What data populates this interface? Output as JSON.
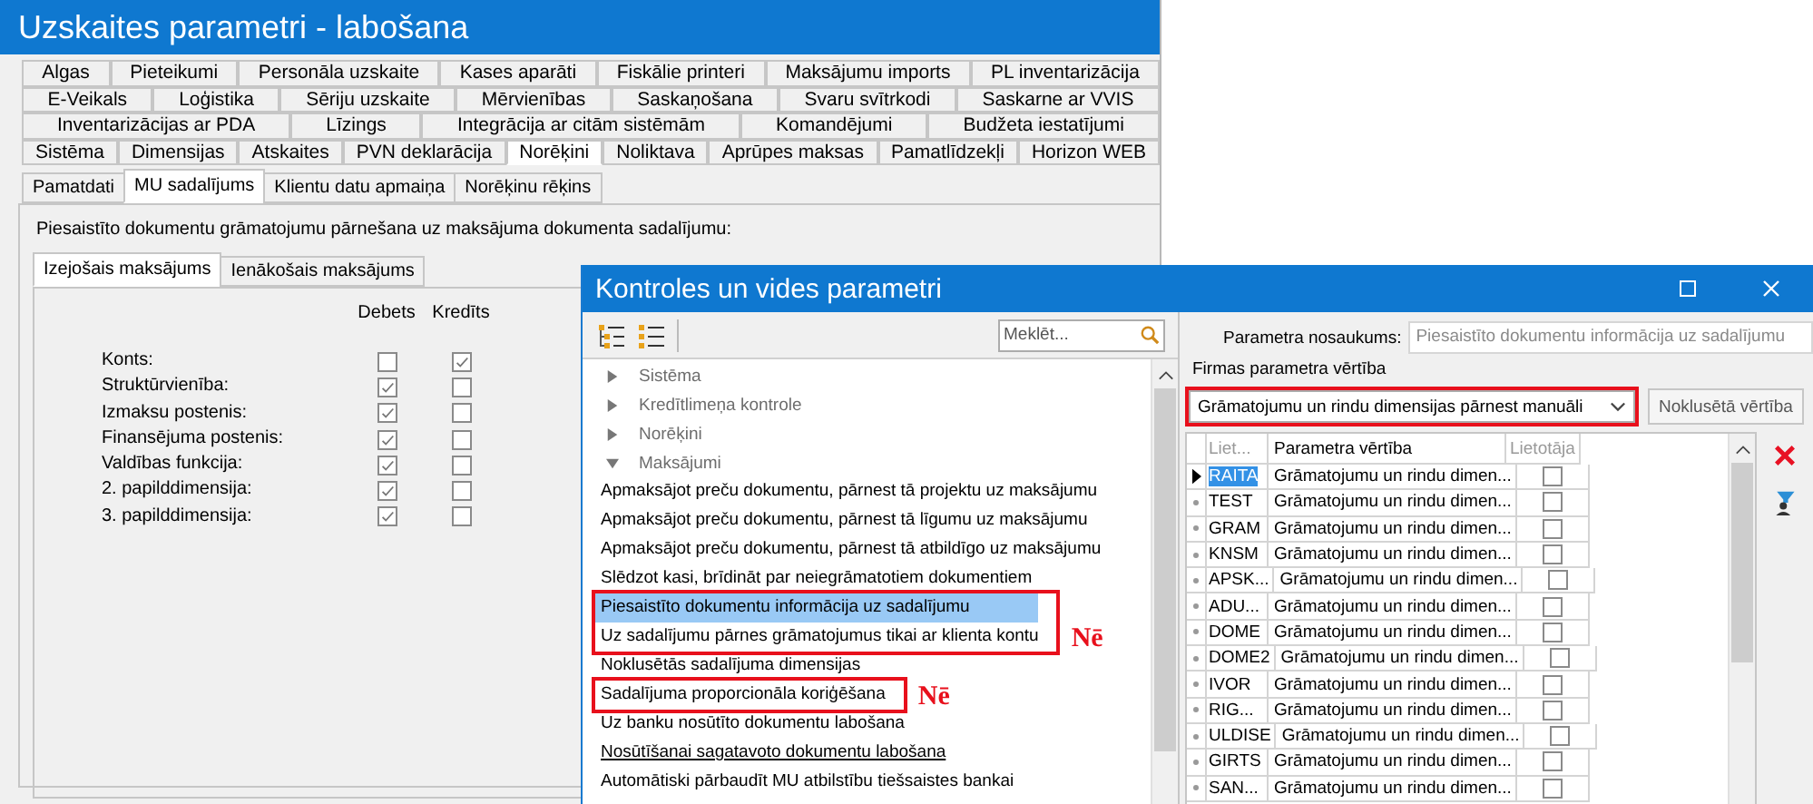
{
  "back_window": {
    "title": "Uzskaites parametri - labošana",
    "tab_rows": [
      [
        {
          "label": "Algas",
          "selected": false
        },
        {
          "label": "Pieteikumi",
          "selected": false
        },
        {
          "label": "Personāla uzskaite",
          "selected": false
        },
        {
          "label": "Kases aparāti",
          "selected": false
        },
        {
          "label": "Fiskālie printeri",
          "selected": false
        },
        {
          "label": "Maksājumu imports",
          "selected": false
        },
        {
          "label": "PL inventarizācija",
          "selected": false
        }
      ],
      [
        {
          "label": "E-Veikals",
          "selected": false
        },
        {
          "label": "Loģistika",
          "selected": false
        },
        {
          "label": "Sēriju uzskaite",
          "selected": false
        },
        {
          "label": "Mērvienības",
          "selected": false
        },
        {
          "label": "Saskaņošana",
          "selected": false
        },
        {
          "label": "Svaru svītrkodi",
          "selected": false
        },
        {
          "label": "Saskarne ar VVIS",
          "selected": false
        }
      ],
      [
        {
          "label": "Inventarizācijas ar PDA",
          "selected": false
        },
        {
          "label": "Līzings",
          "selected": false
        },
        {
          "label": "Integrācija ar citām sistēmām",
          "selected": false
        },
        {
          "label": "Komandējumi",
          "selected": false
        },
        {
          "label": "Budžeta iestatījumi",
          "selected": false
        }
      ],
      [
        {
          "label": "Sistēma",
          "selected": false
        },
        {
          "label": "Dimensijas",
          "selected": false
        },
        {
          "label": "Atskaites",
          "selected": false
        },
        {
          "label": "PVN deklarācija",
          "selected": false
        },
        {
          "label": "Norēķini",
          "selected": true
        },
        {
          "label": "Noliktava",
          "selected": false
        },
        {
          "label": "Aprūpes maksas",
          "selected": false
        },
        {
          "label": "Pamatlīdzekļi",
          "selected": false
        },
        {
          "label": "Horizon WEB",
          "selected": false
        }
      ]
    ],
    "subtabs": [
      {
        "label": "Pamatdati",
        "selected": false
      },
      {
        "label": "MU sadalījums",
        "selected": true
      },
      {
        "label": "Klientu datu apmaiņa",
        "selected": false
      },
      {
        "label": "Norēķinu rēķins",
        "selected": false
      }
    ],
    "description": "Piesaistīto dokumentu grāmatojumu pārnešana uz maksājuma dokumenta sadalījumu:",
    "direction_tabs": [
      {
        "label": "Izejošais maksājums",
        "selected": true
      },
      {
        "label": "Ienākošais maksājums",
        "selected": false
      }
    ],
    "columns": [
      "Debets",
      "Kredīts"
    ],
    "rows": [
      {
        "label": "Konts:",
        "debit": false,
        "credit": true
      },
      {
        "label": "Struktūrvienība:",
        "debit": true,
        "credit": false
      },
      {
        "label": "Izmaksu postenis:",
        "debit": true,
        "credit": false
      },
      {
        "label": "Finansējuma postenis:",
        "debit": true,
        "credit": false
      },
      {
        "label": "Valdības funkcija:",
        "debit": true,
        "credit": false
      },
      {
        "label": "2. papilddimensija:",
        "debit": true,
        "credit": false
      },
      {
        "label": "3. papilddimensija:",
        "debit": true,
        "credit": false
      }
    ]
  },
  "front_window": {
    "title": "Kontroles un vides parametri",
    "search": {
      "placeholder": "Meklēt..."
    },
    "tree": [
      {
        "label": "Sistēma",
        "expanded": false
      },
      {
        "label": "Kredītlimeņa kontrole",
        "expanded": false
      },
      {
        "label": "Norēķini",
        "expanded": false
      },
      {
        "label": "Maksājumi",
        "expanded": true,
        "children": [
          {
            "kind": "item",
            "label": "Apmaksājot preču dokumentu, pārnest tā projektu uz maksājumu",
            "selected": false,
            "hovered": false
          },
          {
            "kind": "item",
            "label": "Apmaksājot preču dokumentu, pārnest tā līgumu uz maksājumu",
            "selected": false,
            "hovered": false
          },
          {
            "kind": "item",
            "label": "Apmaksājot preču dokumentu, pārnest tā atbildīgo uz maksājumu",
            "selected": false,
            "hovered": false
          },
          {
            "kind": "item",
            "label": "Slēdzot kasi, brīdināt par neiegrāmatotiem dokumentiem",
            "selected": false,
            "hovered": false
          },
          {
            "kind": "annotated_group",
            "note": "Nē",
            "items": [
              {
                "label": "Piesaistīto dokumentu informācija uz sadalījumu",
                "selected": true,
                "hovered": false
              },
              {
                "label": "Uz sadalījumu pārnes grāmatojumus tikai ar klienta kontu",
                "selected": false,
                "hovered": false
              }
            ]
          },
          {
            "kind": "item",
            "label": "Noklusētās sadalījuma dimensijas",
            "selected": false,
            "hovered": false
          },
          {
            "kind": "annotated_group",
            "note": "Nē",
            "items": [
              {
                "label": "Sadalījuma proporcionāla koriģēšana",
                "selected": false,
                "hovered": false
              }
            ]
          },
          {
            "kind": "item",
            "label": "Uz banku nosūtīto dokumentu labošana",
            "selected": false,
            "hovered": false
          },
          {
            "kind": "item",
            "label": "Nosūtīšanai sagatavoto dokumentu labošana",
            "selected": false,
            "hovered": true
          },
          {
            "kind": "item",
            "label": "Automātiski pārbaudīt MU atbilstību tiešsaistes bankai",
            "selected": false,
            "hovered": false
          }
        ]
      }
    ],
    "parameter_name": {
      "label": "Parametra nosaukums:",
      "value": "Piesaistīto dokumentu informācija uz sadalījumu"
    },
    "company_value": {
      "label": "Firmas parametra vērtība",
      "value": "Grāmatojumu un rindu dimensijas pārnest manuāli",
      "annotated": true
    },
    "default_button": "Noklusētā vērtība",
    "grid": {
      "columns": [
        "Liet...",
        "Parametra vērtība",
        "Lietotāja"
      ],
      "rows": [
        {
          "user": "RAITA",
          "value": "Grāmatojumu un rindu dimen...",
          "checked": false,
          "current": true
        },
        {
          "user": "TEST",
          "value": "Grāmatojumu un rindu dimen...",
          "checked": false,
          "current": false
        },
        {
          "user": "GRAM",
          "value": "Grāmatojumu un rindu dimen...",
          "checked": false,
          "current": false
        },
        {
          "user": "KNSM",
          "value": "Grāmatojumu un rindu dimen...",
          "checked": false,
          "current": false
        },
        {
          "user": "APSK...",
          "value": "Grāmatojumu un rindu dimen...",
          "checked": false,
          "current": false
        },
        {
          "user": "ADU...",
          "value": "Grāmatojumu un rindu dimen...",
          "checked": false,
          "current": false
        },
        {
          "user": "DOME",
          "value": "Grāmatojumu un rindu dimen...",
          "checked": false,
          "current": false
        },
        {
          "user": "DOME2",
          "value": "Grāmatojumu un rindu dimen...",
          "checked": false,
          "current": false
        },
        {
          "user": "IVOR",
          "value": "Grāmatojumu un rindu dimen...",
          "checked": false,
          "current": false
        },
        {
          "user": "RIG...",
          "value": "Grāmatojumu un rindu dimen...",
          "checked": false,
          "current": false
        },
        {
          "user": "ULDISE",
          "value": "Grāmatojumu un rindu dimen...",
          "checked": false,
          "current": false
        },
        {
          "user": "GIRTS",
          "value": "Grāmatojumu un rindu dimen...",
          "checked": false,
          "current": false
        },
        {
          "user": "SAN...",
          "value": "Grāmatojumu un rindu dimen...",
          "checked": false,
          "current": false
        }
      ]
    }
  }
}
